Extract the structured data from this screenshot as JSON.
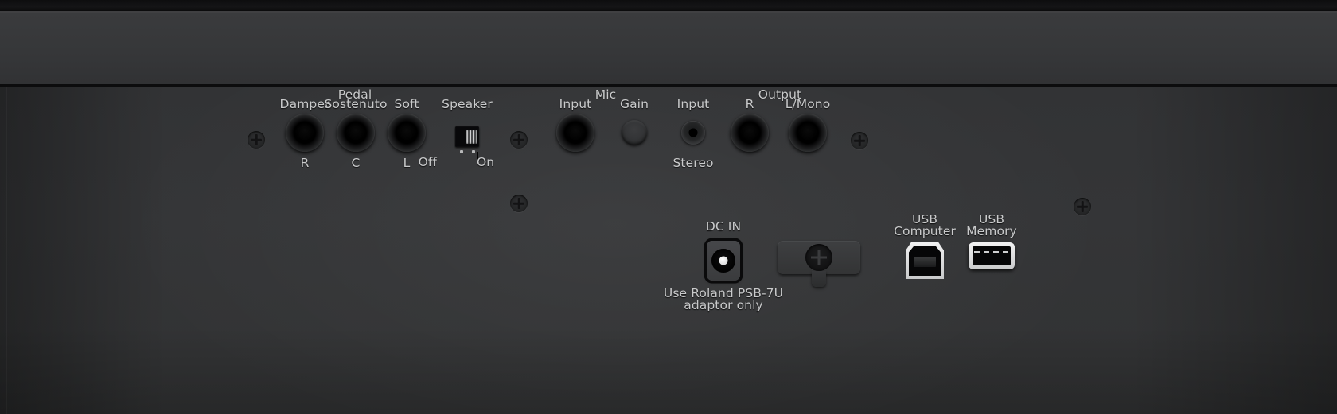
{
  "device": {
    "name": "roland-digital-piano-rear-panel",
    "panel_color": "#333436",
    "label_color": "#c9cacb"
  },
  "groups": {
    "pedal": {
      "title": "Pedal"
    },
    "mic": {
      "title": "Mic"
    },
    "output": {
      "title": "Output"
    }
  },
  "connectors": {
    "pedal_damper": {
      "label": "Damper",
      "sublabel": "R",
      "icon": "trs-jack-icon"
    },
    "pedal_sostenuto": {
      "label": "Sostenuto",
      "sublabel": "C",
      "icon": "trs-jack-icon"
    },
    "pedal_soft": {
      "label": "Soft",
      "sublabel": "L",
      "icon": "trs-jack-icon"
    },
    "speaker": {
      "label": "Speaker",
      "off": "Off",
      "on": "On",
      "icon": "slide-switch-icon"
    },
    "mic_input": {
      "label": "Input",
      "icon": "trs-jack-icon"
    },
    "mic_gain": {
      "label": "Gain",
      "icon": "rotary-knob-icon"
    },
    "stereo_input": {
      "label": "Input",
      "sublabel": "Stereo",
      "icon": "mini-jack-icon"
    },
    "output_r": {
      "label": "R",
      "icon": "trs-jack-icon"
    },
    "output_l_mono": {
      "label": "L/Mono",
      "icon": "trs-jack-icon"
    },
    "dc_in": {
      "label": "DC IN",
      "note_line1": "Use Roland PSB-7U",
      "note_line2": "adaptor only",
      "icon": "dc-power-jack-icon"
    },
    "cord_hook": {
      "icon": "cord-hook-icon"
    },
    "usb_computer": {
      "label_line1": "USB",
      "label_line2": "Computer",
      "icon": "usb-b-port-icon"
    },
    "usb_memory": {
      "label_line1": "USB",
      "label_line2": "Memory",
      "icon": "usb-a-port-icon"
    }
  },
  "screws": {
    "icon": "phillips-screw-icon",
    "count": 6
  }
}
